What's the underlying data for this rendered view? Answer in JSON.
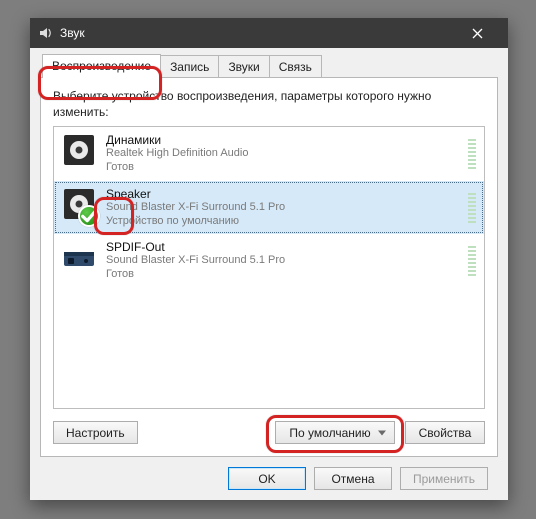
{
  "window": {
    "title": "Звук"
  },
  "tabs": {
    "items": [
      {
        "label": "Воспроизведение",
        "active": true
      },
      {
        "label": "Запись",
        "active": false
      },
      {
        "label": "Звуки",
        "active": false
      },
      {
        "label": "Связь",
        "active": false
      }
    ],
    "instruction": "Выберите устройство воспроизведения, параметры которого нужно изменить:"
  },
  "devices": [
    {
      "name": "Динамики",
      "driver": "Realtek High Definition Audio",
      "status": "Готов",
      "icon": "speaker-box",
      "selected": false,
      "default": false
    },
    {
      "name": "Speaker",
      "driver": "Sound Blaster X-Fi Surround 5.1 Pro",
      "status": "Устройство по умолчанию",
      "icon": "speaker-box",
      "selected": true,
      "default": true
    },
    {
      "name": "SPDIF-Out",
      "driver": "Sound Blaster X-Fi Surround 5.1 Pro",
      "status": "Готов",
      "icon": "spdif-device",
      "selected": false,
      "default": false
    }
  ],
  "buttons": {
    "configure": "Настроить",
    "set_default": "По умолчанию",
    "properties": "Свойства",
    "ok": "OK",
    "cancel": "Отмена",
    "apply": "Применить"
  }
}
